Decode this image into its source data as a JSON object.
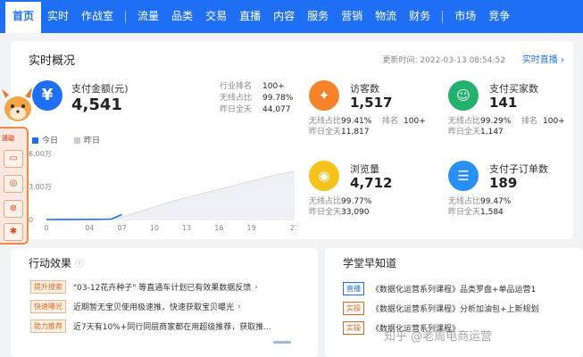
{
  "nav": {
    "items": [
      "首页",
      "实时",
      "作战室",
      "流量",
      "品类",
      "交易",
      "直播",
      "内容",
      "服务",
      "营销",
      "物流",
      "财务",
      "市场",
      "竞争"
    ]
  },
  "overview": {
    "title": "实时概况",
    "update_time": "更新时间: 2022-03-13 08:54:52",
    "live_link": "实时直播",
    "payment": {
      "label": "支付金额(元)",
      "value": "4,541",
      "stats": [
        {
          "k": "行业排名",
          "v": "100+"
        },
        {
          "k": "无线占比",
          "v": "99.78%"
        },
        {
          "k": "昨日全天",
          "v": "44,077"
        }
      ]
    },
    "legend": {
      "today": "今日",
      "yesterday": "昨日"
    },
    "metrics": [
      {
        "label": "访客数",
        "value": "1,517",
        "color": "#f5832a",
        "icon": "footprint-icon",
        "rows": [
          [
            "无线占比",
            "99.41%",
            "排名",
            "100+"
          ],
          [
            "昨日全天",
            "11,817",
            "",
            ""
          ]
        ]
      },
      {
        "label": "支付买家数",
        "value": "141",
        "color": "#23b26d",
        "icon": "user-icon",
        "rows": [
          [
            "无线占比",
            "99.29%",
            "排名",
            "100+"
          ],
          [
            "昨日全天",
            "1,147",
            "",
            ""
          ]
        ]
      },
      {
        "label": "浏览量",
        "value": "4,712",
        "color": "#f6c31c",
        "icon": "eye-icon",
        "rows": [
          [
            "无线占比",
            "99.77%",
            "",
            ""
          ],
          [
            "昨日全天",
            "33,090",
            "",
            ""
          ]
        ]
      },
      {
        "label": "支付子订单数",
        "value": "189",
        "color": "#2a8ff5",
        "icon": "order-icon",
        "rows": [
          [
            "无线占比",
            "99.47%",
            "",
            ""
          ],
          [
            "昨日全天",
            "1,584",
            "",
            ""
          ]
        ]
      }
    ]
  },
  "chart_data": {
    "type": "area",
    "x": [
      0,
      1,
      2,
      3,
      4,
      5,
      6,
      7,
      8,
      9,
      10,
      11,
      12,
      13,
      14,
      15,
      16,
      17,
      18,
      19,
      20,
      21,
      22,
      23
    ],
    "x_tick_labels": [
      "0",
      "04",
      "07",
      "10",
      "13",
      "16",
      "19",
      "23"
    ],
    "y_tick_labels": [
      "0",
      "3.00万",
      "6.00万"
    ],
    "ylim": [
      0,
      60000
    ],
    "series": [
      {
        "name": "今日",
        "color": "#1f6ff5",
        "values": [
          0,
          80,
          120,
          150,
          170,
          200,
          400,
          4541
        ]
      },
      {
        "name": "昨日",
        "color": "#d9dce3",
        "values": [
          0,
          100,
          150,
          200,
          250,
          320,
          800,
          2200,
          5200,
          8500,
          11500,
          14500,
          17500,
          20000,
          22500,
          25000,
          27500,
          30000,
          32500,
          35000,
          37500,
          40000,
          42000,
          44077
        ]
      }
    ],
    "grid": false,
    "legend": "top-left"
  },
  "side": {
    "tag": "活动"
  },
  "actions": {
    "title": "行动效果",
    "rows": [
      {
        "badge": "提升搜索",
        "text": "\"03-12花卉种子\" 等直通车计划已有效果数据反馈"
      },
      {
        "badge": "快速曝光",
        "text": "近期暂无宝贝使用极速推，快速获取宝贝曝光"
      },
      {
        "badge": "助力推荐",
        "text": "近7天有10%+同行同层商家都在用超级推荐，获取推..."
      }
    ]
  },
  "study": {
    "title": "学堂早知道",
    "rows": [
      {
        "badge": "直播",
        "badge_color": "#1f6ff5",
        "text": "《数据化运营系列课程》品类罗盘+单品运营1"
      },
      {
        "badge": "实操",
        "badge_color": "#e0661f",
        "text": "《数据化运营系列课程》分析加油包+上新规划"
      },
      {
        "badge": "实操",
        "badge_color": "#e0661f",
        "text": "《数据化运营系列课程》"
      }
    ]
  },
  "watermark": "知乎 @老周电商运营"
}
